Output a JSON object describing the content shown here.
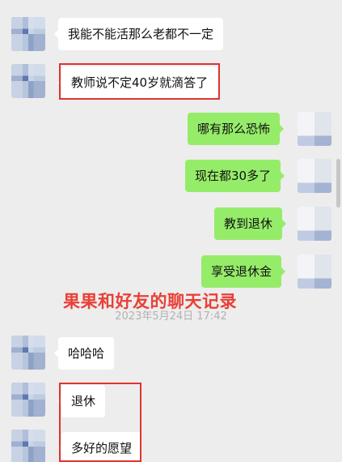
{
  "chat": {
    "messages": [
      {
        "side": "left",
        "text": "我能不能活那么老都不一定"
      },
      {
        "side": "left",
        "text": "教师说不定40岁就滴答了"
      },
      {
        "side": "right",
        "text": "哪有那么恐怖"
      },
      {
        "side": "right",
        "text": "现在都30多了"
      },
      {
        "side": "right",
        "text": "教到退休"
      },
      {
        "side": "right",
        "text": "享受退休金"
      },
      {
        "side": "left",
        "text": "哈哈哈"
      },
      {
        "side": "left",
        "text": "退休"
      },
      {
        "side": "left",
        "text": "多好的愿望"
      }
    ],
    "timestamp": "2023年5月24日 17:42",
    "overlay_caption": "果果和好友的聊天记录"
  },
  "colors": {
    "background": "#ededed",
    "self_bubble": "#95ec69",
    "other_bubble": "#ffffff",
    "highlight": "#e0342f",
    "caption": "#ea3f36"
  }
}
